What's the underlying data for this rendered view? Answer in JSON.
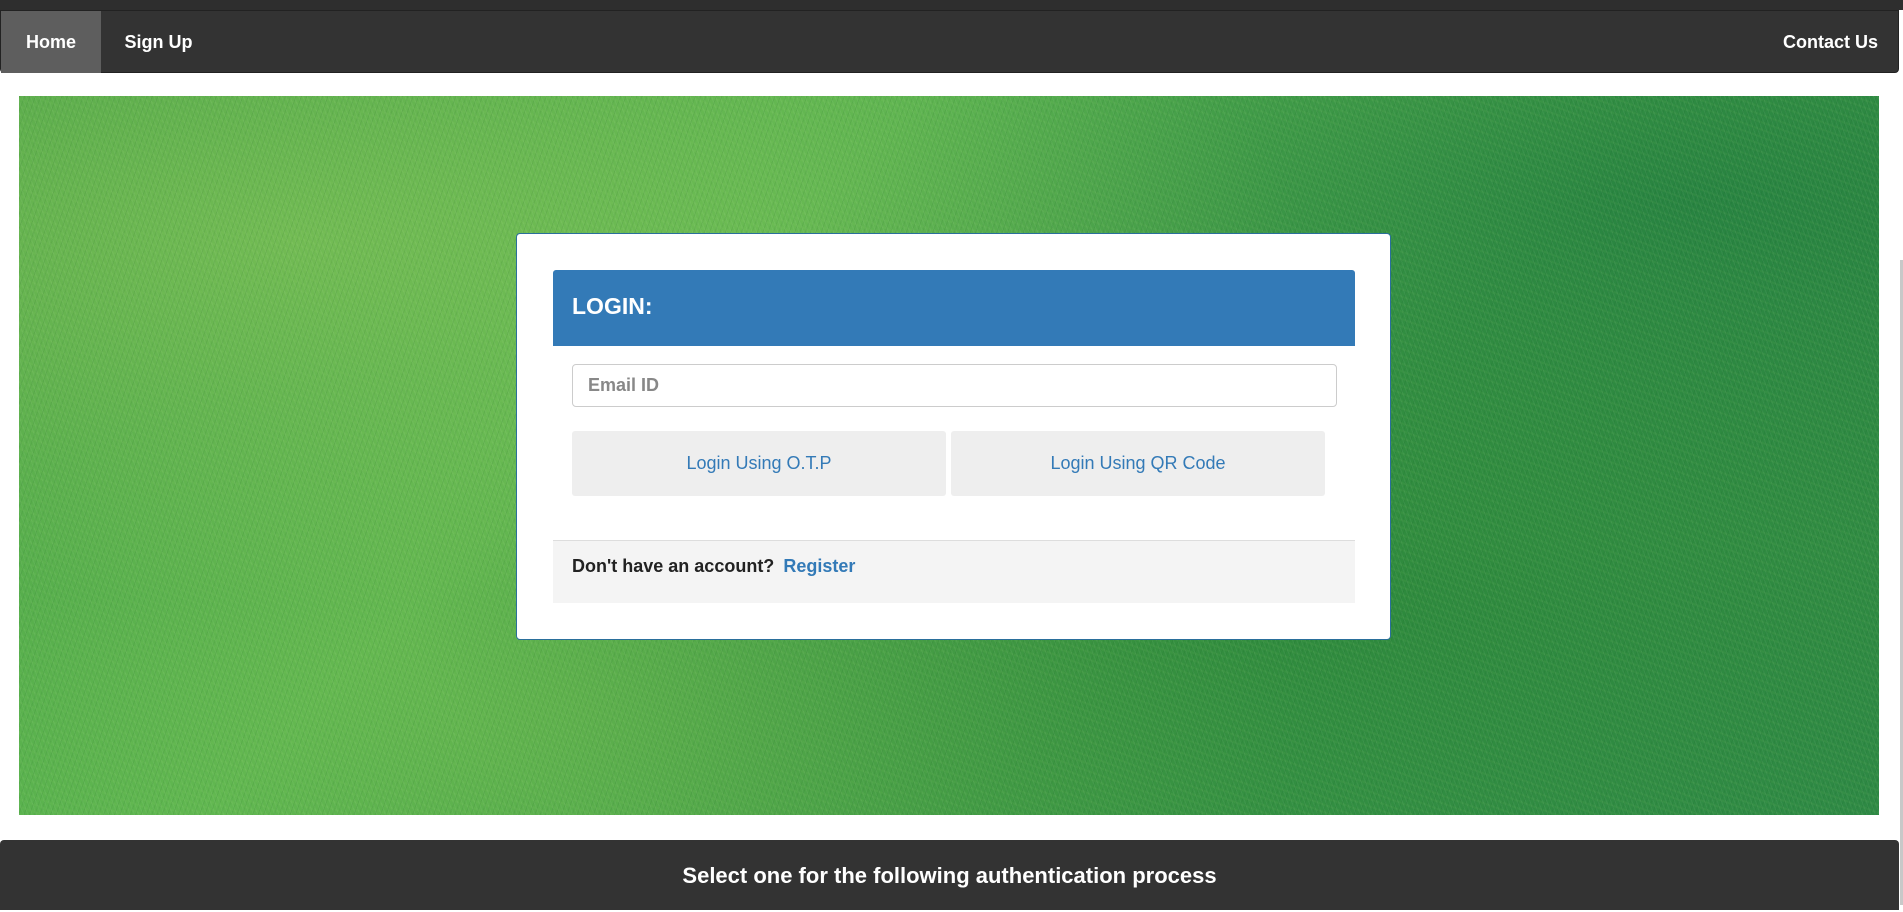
{
  "navbar": {
    "home_label": "Home",
    "signup_label": "Sign Up",
    "contact_label": "Contact Us"
  },
  "login": {
    "title": "LOGIN:",
    "email_placeholder": "Email ID",
    "otp_button_label": "Login Using O.T.P",
    "qr_button_label": "Login Using QR Code",
    "footer_text": "Don't have an account?",
    "register_label": "Register"
  },
  "footer_bar": {
    "text": "Select one for the following authentication process"
  },
  "colors": {
    "navbar_bg": "#333333",
    "active_nav_bg": "#5e5e5e",
    "primary": "#337ab7",
    "button_bg": "#eeeeee"
  }
}
